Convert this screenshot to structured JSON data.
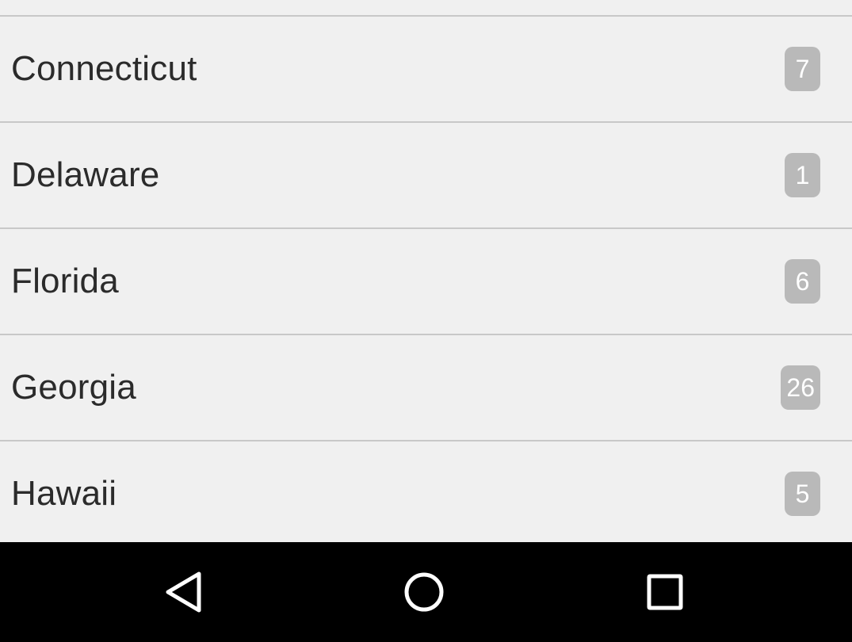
{
  "list": {
    "items": [
      {
        "label": "Connecticut",
        "count": "7"
      },
      {
        "label": "Delaware",
        "count": "1"
      },
      {
        "label": "Florida",
        "count": "6"
      },
      {
        "label": "Georgia",
        "count": "26"
      },
      {
        "label": "Hawaii",
        "count": "5"
      }
    ]
  },
  "navbar": {
    "buttons": [
      {
        "icon": "back-triangle-icon"
      },
      {
        "icon": "home-circle-icon"
      },
      {
        "icon": "recents-square-icon"
      }
    ]
  },
  "colors": {
    "list_background": "#f0f0f0",
    "divider": "#c8c8c8",
    "badge_background": "#b9b9b9",
    "label_text": "#2b2b2b",
    "navbar_background": "#000000"
  }
}
